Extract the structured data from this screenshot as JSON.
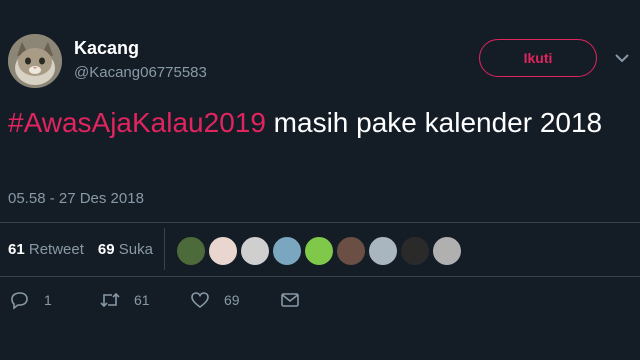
{
  "user": {
    "name": "Kacang",
    "handle": "@Kacang06775583"
  },
  "follow_button": {
    "label": "Ikuti"
  },
  "tweet": {
    "hashtag": "#AwasAjaKalau2019",
    "text": " masih pake kalender 2018",
    "timestamp": "05.58 - 27 Des 2018"
  },
  "stats": {
    "retweets_count": "61",
    "retweets_label": "Retweet",
    "likes_count": "69",
    "likes_label": "Suka"
  },
  "actions": {
    "reply_count": "1",
    "retweet_count": "61",
    "like_count": "69"
  },
  "colors": {
    "background": "#141d26",
    "accent": "#e0245e",
    "muted": "#8899a6",
    "divider": "#38444d"
  }
}
